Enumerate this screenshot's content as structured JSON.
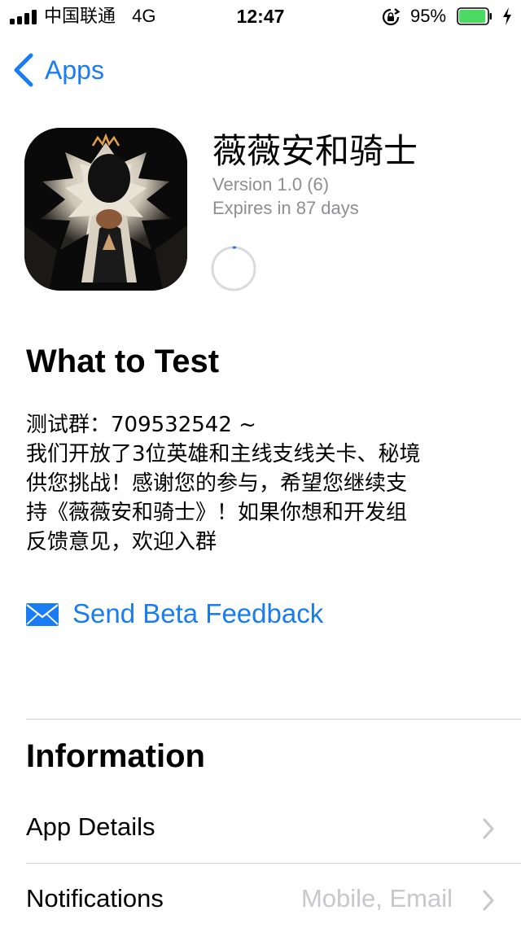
{
  "status_bar": {
    "carrier": "中国联通",
    "network": "4G",
    "time": "12:47",
    "battery_percent": "95%",
    "battery_level": 0.95,
    "battery_color": "#4cd964"
  },
  "nav": {
    "back_label": "Apps"
  },
  "app": {
    "name": "薇薇安和骑士",
    "version": "Version 1.0 (6)",
    "expires": "Expires in 87 days",
    "install_progress": 0.01
  },
  "what_to_test": {
    "title": "What to Test",
    "lines": [
      "测试群：709532542 ~",
      "我们开放了3位英雄和主线支线关卡、秘境",
      "供您挑战！感谢您的参与，希望您继续支",
      "持《薇薇安和骑士》！如果你想和开发组",
      "反馈意见，欢迎入群"
    ]
  },
  "feedback": {
    "label": "Send Beta Feedback",
    "icon": "envelope-icon"
  },
  "information": {
    "title": "Information",
    "rows": [
      {
        "label": "App Details",
        "value": ""
      },
      {
        "label": "Notifications",
        "value": "Mobile, Email"
      }
    ]
  },
  "colors": {
    "accent": "#1a7cf3",
    "secondary_text": "#8e8e93",
    "divider": "#d1d1d6",
    "chevron": "#c7c7cc"
  }
}
